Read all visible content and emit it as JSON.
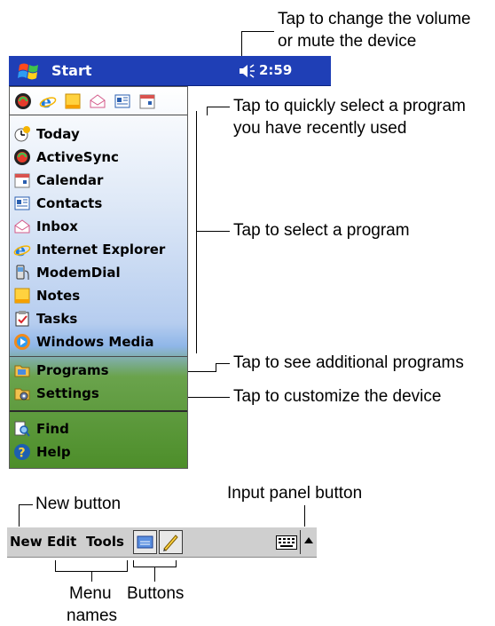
{
  "callouts": {
    "volume_line1": "Tap to change the volume",
    "volume_line2": "or mute the device",
    "recent_line1": "Tap to quickly select a program",
    "recent_line2": "you have recently used",
    "select_program": "Tap to select a program",
    "additional_programs": "Tap to see additional programs",
    "customize": "Tap to customize the device",
    "new_button": "New button",
    "input_panel": "Input panel button",
    "menu_names_line1": "Menu",
    "menu_names_line2": "names",
    "buttons": "Buttons"
  },
  "titlebar": {
    "start_label": "Start",
    "time": "2:59"
  },
  "menu": {
    "recent_icons": [
      "activesync-icon",
      "internet-explorer-icon",
      "notes-icon",
      "inbox-icon",
      "contacts-icon",
      "calendar-icon"
    ],
    "programs": [
      {
        "label": "Today",
        "icon": "today-icon"
      },
      {
        "label": "ActiveSync",
        "icon": "activesync-icon"
      },
      {
        "label": "Calendar",
        "icon": "calendar-icon"
      },
      {
        "label": "Contacts",
        "icon": "contacts-icon"
      },
      {
        "label": "Inbox",
        "icon": "inbox-icon"
      },
      {
        "label": "Internet Explorer",
        "icon": "internet-explorer-icon"
      },
      {
        "label": "ModemDial",
        "icon": "modemdial-icon"
      },
      {
        "label": "Notes",
        "icon": "notes-icon"
      },
      {
        "label": "Tasks",
        "icon": "tasks-icon"
      },
      {
        "label": "Windows Media",
        "icon": "windows-media-icon"
      }
    ],
    "programs_folder": "Programs",
    "settings": "Settings",
    "find": "Find",
    "help": "Help"
  },
  "toolbar": {
    "new_label": "New",
    "edit_label": "Edit",
    "tools_label": "Tools"
  },
  "colors": {
    "titlebar": "#1f3fb6",
    "menu_top": "#ffffff",
    "menu_grass": "#4d8e2a"
  }
}
